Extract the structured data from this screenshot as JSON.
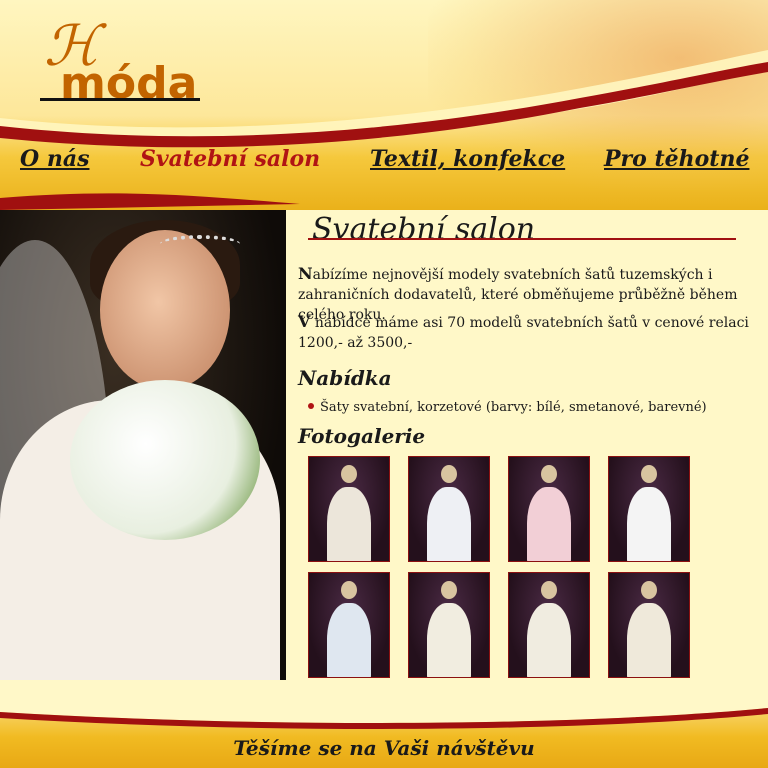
{
  "logo": {
    "text": "móda"
  },
  "nav": {
    "items": [
      {
        "label": "O nás"
      },
      {
        "label": "Svatební salon"
      },
      {
        "label": "Textil, konfekce"
      },
      {
        "label": "Pro těhotné"
      }
    ]
  },
  "content": {
    "title": "Svatební salon",
    "para1_initial": "N",
    "para1_rest": "abízíme nejnovější modely svatebních šatů tuzemských i zahraničních dodavatelů, které obměňujeme průběžně během celého roku.",
    "para2_initial": "V",
    "para2_rest": " nabídce máme asi 70 modelů svatebních šatů v cenové relaci 1200,- až 3500,-",
    "offer_heading": "Nabídka",
    "offer_items": [
      "Šaty svatební, korzetové (barvy: bílé, smetanové, barevné)"
    ],
    "gallery_heading": "Fotogalerie",
    "gallery": [
      {
        "gown_color": "#ece6da"
      },
      {
        "gown_color": "#eef0f4"
      },
      {
        "gown_color": "#f2cfd6"
      },
      {
        "gown_color": "#f4f4f4"
      },
      {
        "gown_color": "#dfe7f0"
      },
      {
        "gown_color": "#f1ede0"
      },
      {
        "gown_color": "#f0ece0"
      },
      {
        "gown_color": "#efe9da"
      }
    ]
  },
  "footer": {
    "text": "Těšíme se na Vaši návštěvu"
  },
  "colors": {
    "accent": "#b01414",
    "bg": "#fff8c8",
    "gold": "#f1bb22"
  }
}
